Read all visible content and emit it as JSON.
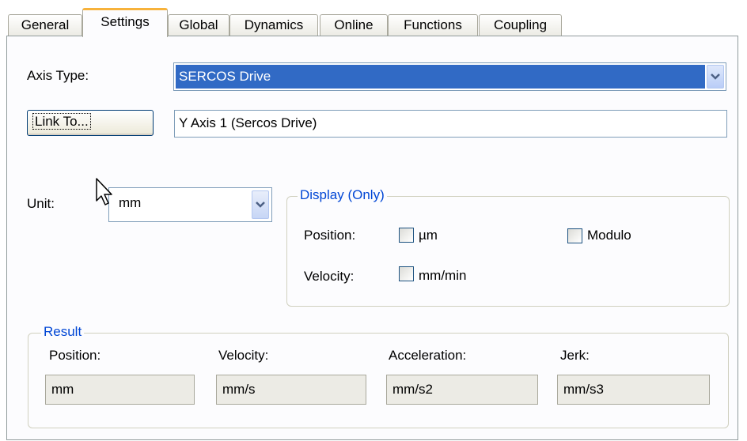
{
  "tabs": [
    {
      "label": "General"
    },
    {
      "label": "Settings"
    },
    {
      "label": "Global"
    },
    {
      "label": "Dynamics"
    },
    {
      "label": "Online"
    },
    {
      "label": "Functions"
    },
    {
      "label": "Coupling"
    }
  ],
  "active_tab": "Settings",
  "axis_type": {
    "label": "Axis Type:",
    "value": "SERCOS Drive"
  },
  "link_to": {
    "button_label": "Link To...",
    "value": "Y Axis 1 (Sercos Drive)"
  },
  "unit": {
    "label": "Unit:",
    "value": "mm"
  },
  "display": {
    "title": "Display (Only)",
    "position_label": "Position:",
    "velocity_label": "Velocity:",
    "um_label": "µm",
    "modulo_label": "Modulo",
    "mm_min_label": "mm/min",
    "um_checked": false,
    "modulo_checked": false,
    "mm_min_checked": false
  },
  "result": {
    "title": "Result",
    "position_label": "Position:",
    "position_value": "mm",
    "velocity_label": "Velocity:",
    "velocity_value": "mm/s",
    "acceleration_label": "Acceleration:",
    "acceleration_value": "mm/s2",
    "jerk_label": "Jerk:",
    "jerk_value": "mm/s3"
  },
  "colors": {
    "active_tab_accent": "#f7b23b",
    "selection": "#316ac5",
    "group_title": "#0046d5"
  }
}
